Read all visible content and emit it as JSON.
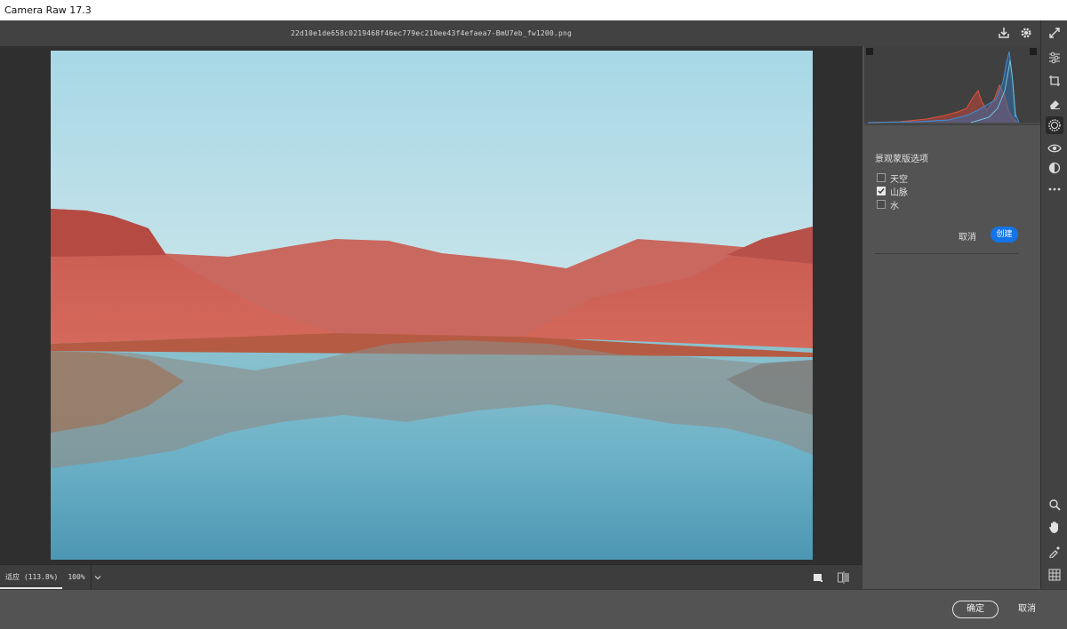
{
  "window": {
    "title": "Camera Raw 17.3"
  },
  "topbar": {
    "filename": "22d10e1de658c0219468f46ec779ec210ee43f4efaea7-BmU7eb_fw1200.png",
    "save_icon": "download-icon",
    "settings_icon": "gear-icon",
    "fullscreen_icon": "expand-icon"
  },
  "histogram": {
    "colors": {
      "red": "#e0523a",
      "blue": "#3f8fd6",
      "cyan": "#6fc3d9"
    }
  },
  "options_panel": {
    "title": "景观蒙版选项",
    "items": [
      {
        "label": "天空",
        "checked": false
      },
      {
        "label": "山脉",
        "checked": true
      },
      {
        "label": "水",
        "checked": false
      }
    ],
    "cancel_label": "取消",
    "create_label": "创建"
  },
  "bottombar": {
    "zoom_fit_label": "适应 (113.8%)",
    "zoom_100_label": "100%",
    "chevron_icon": "chevron-down-icon",
    "view_mode_icon": "single-view-icon",
    "compare_icon": "before-after-icon"
  },
  "toolstrip": {
    "tools": [
      {
        "name": "edit-sliders-icon",
        "active": false
      },
      {
        "name": "crop-icon",
        "active": false
      },
      {
        "name": "eraser-icon",
        "active": false
      },
      {
        "name": "masking-icon",
        "active": true
      },
      {
        "name": "redeye-icon",
        "active": false
      },
      {
        "name": "presets-icon",
        "active": false
      },
      {
        "name": "more-icon",
        "active": false
      }
    ],
    "bottom_tools": [
      "zoom-icon",
      "hand-icon",
      "eyedropper-icon",
      "grid-icon"
    ]
  },
  "footer": {
    "ok_label": "确定",
    "cancel_label": "取消"
  },
  "accent_color": "#1473e6"
}
